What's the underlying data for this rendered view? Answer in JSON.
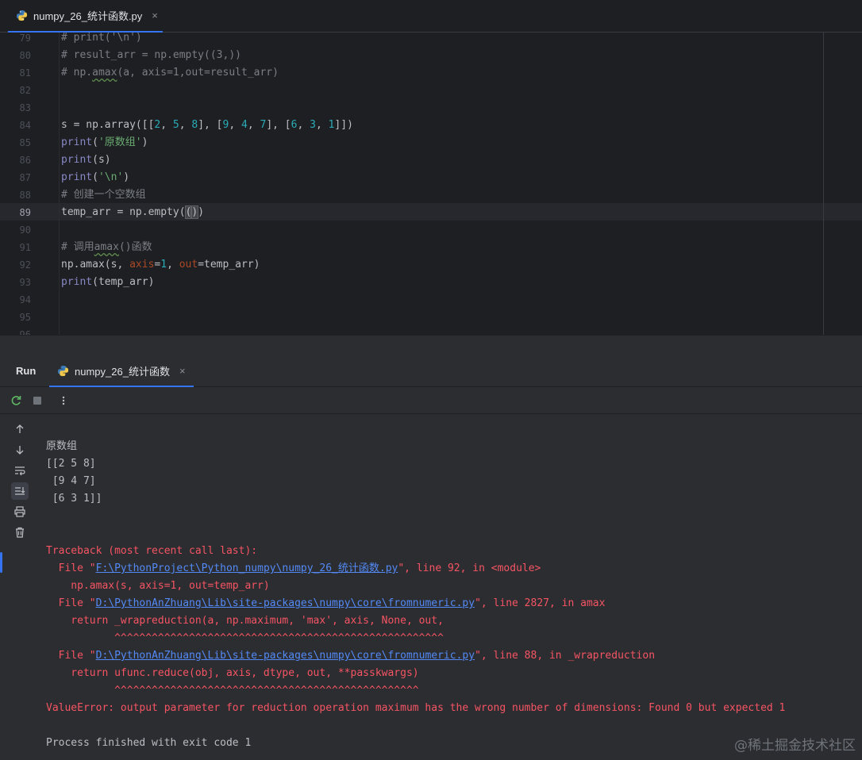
{
  "editor_tab": {
    "label": "numpy_26_统计函数.py",
    "close": "×"
  },
  "editor": {
    "line_numbers": [
      "79",
      "80",
      "81",
      "82",
      "83",
      "84",
      "85",
      "86",
      "87",
      "88",
      "89",
      "90",
      "91",
      "92",
      "93",
      "94",
      "95",
      "96"
    ],
    "current_line": "89",
    "lines": {
      "l79": "# print('\\n')",
      "l80": "# result_arr = np.empty((3,))",
      "l81a": "# np.",
      "l81b": "amax",
      "l81c": "(a, axis=1,out=result_arr)",
      "l84": {
        "a": "s = np.array([[",
        "n1": "2",
        "s1": ", ",
        "n2": "5",
        "s2": ", ",
        "n3": "8",
        "s3": "], [",
        "n4": "9",
        "s4": ", ",
        "n5": "4",
        "s5": ", ",
        "n6": "7",
        "s6": "], [",
        "n7": "6",
        "s7": ", ",
        "n8": "3",
        "s8": ", ",
        "n9": "1",
        "s9": "]])"
      },
      "l85": {
        "fn": "print",
        "open": "(",
        "str": "'原数组'",
        "close": ")"
      },
      "l86": {
        "fn": "print",
        "rest": "(s)"
      },
      "l87": {
        "fn": "print",
        "open": "(",
        "str": "'\\n'",
        "close": ")"
      },
      "l88": "# 创建一个空数组",
      "l89": {
        "a": "temp_arr = np.empty(",
        "b": "(",
        "c": ")",
        "d": ")"
      },
      "l91": {
        "a": "# 调用",
        "b": "amax",
        "c": "()函数"
      },
      "l92": {
        "a": "np.amax(s, ",
        "p1": "axis",
        "eq1": "=",
        "n1": "1",
        "s1": ", ",
        "p2": "out",
        "rest": "=temp_arr)"
      },
      "l93": {
        "fn": "print",
        "rest": "(temp_arr)"
      }
    }
  },
  "run_panel": {
    "title": "Run",
    "tab_label": "numpy_26_统计函数",
    "tab_close": "×"
  },
  "console": {
    "out1": "原数组",
    "out2": "[[2 5 8]",
    "out3": " [9 4 7]",
    "out4": " [6 3 1]]",
    "tb_header": "Traceback (most recent call last):",
    "f1_pre": "  File \"",
    "f1_link": "F:\\PythonProject\\Python_numpy\\numpy_26_统计函数.py",
    "f1_post": "\", line 92, in <module>",
    "f1_code": "    np.amax(s, axis=1, out=temp_arr)",
    "f2_pre": "  File \"",
    "f2_link": "D:\\PythonAnZhuang\\Lib\\site-packages\\numpy\\core\\fromnumeric.py",
    "f2_post": "\", line 2827, in amax",
    "f2_code": "    return _wrapreduction(a, np.maximum, 'max', axis, None, out,",
    "f2_carets": "           ^^^^^^^^^^^^^^^^^^^^^^^^^^^^^^^^^^^^^^^^^^^^^^^^^^^^^",
    "f3_pre": "  File \"",
    "f3_link": "D:\\PythonAnZhuang\\Lib\\site-packages\\numpy\\core\\fromnumeric.py",
    "f3_post": "\", line 88, in _wrapreduction",
    "f3_code": "    return ufunc.reduce(obj, axis, dtype, out, **passkwargs)",
    "f3_carets": "           ^^^^^^^^^^^^^^^^^^^^^^^^^^^^^^^^^^^^^^^^^^^^^^^^^",
    "error": "ValueError: output parameter for reduction operation maximum has the wrong number of dimensions: Found 0 but expected 1",
    "exit": "Process finished with exit code 1"
  },
  "watermark": "@稀土掘金技术社区",
  "icons": [
    "python-file-icon",
    "rerun-icon",
    "stop-icon",
    "more-icon",
    "scroll-up-icon",
    "scroll-down-icon",
    "soft-wrap-icon",
    "scroll-to-end-icon",
    "print-icon",
    "trash-icon"
  ]
}
